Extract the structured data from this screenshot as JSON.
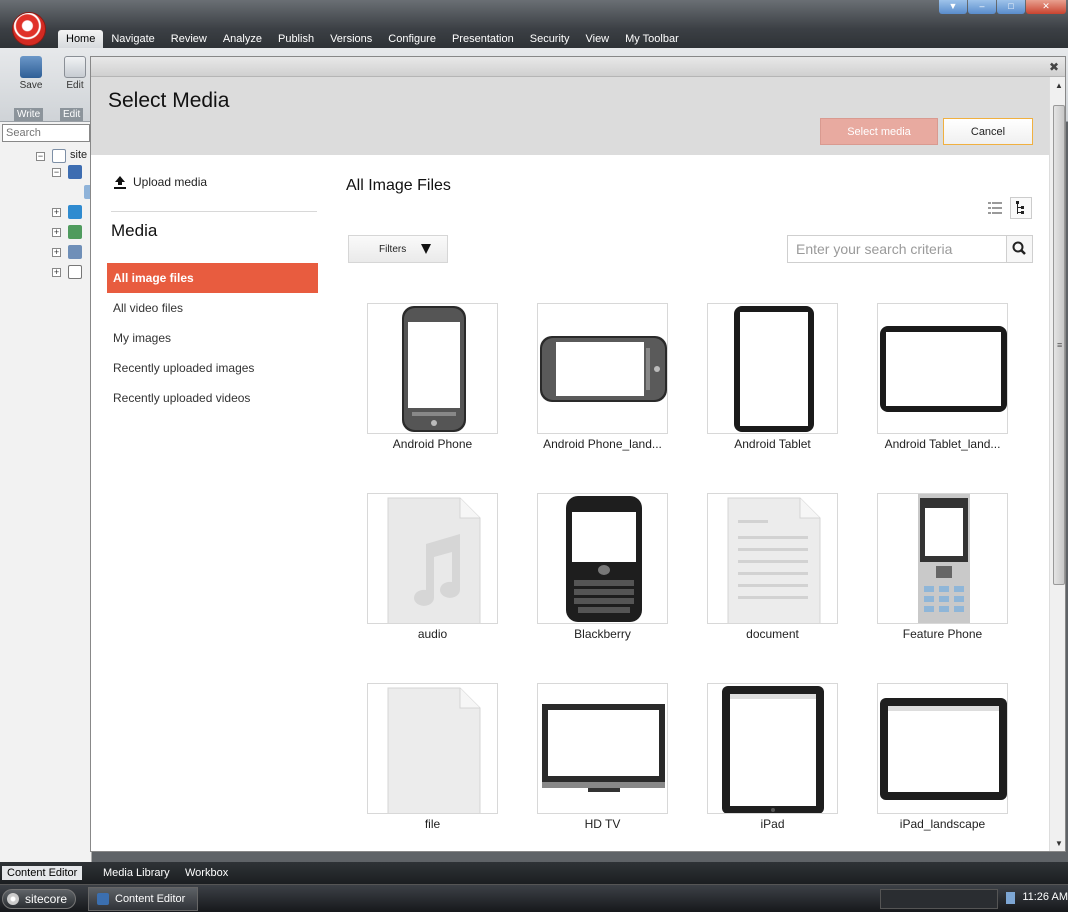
{
  "app": {
    "menu_tabs": [
      "Home",
      "Navigate",
      "Review",
      "Analyze",
      "Publish",
      "Versions",
      "Configure",
      "Presentation",
      "Security",
      "View",
      "My Toolbar"
    ],
    "ribbon": {
      "save_label": "Save",
      "edit_label": "Edit",
      "group_write": "Write",
      "group_edit": "Edit"
    },
    "tree": {
      "search_placeholder": "Search",
      "root_label": "site"
    },
    "bottom_tabs": [
      "Content Editor",
      "Media Library",
      "Workbox"
    ],
    "taskbar": {
      "start_label": "sitecore",
      "task_label": "Content Editor",
      "clock": "11:26 AM"
    }
  },
  "dialog": {
    "title": "Select Media",
    "select_button": "Select media",
    "cancel_button": "Cancel",
    "upload_label": "Upload media",
    "media_heading": "Media",
    "nav_items": [
      "All image files",
      "All video files",
      "My images",
      "Recently uploaded images",
      "Recently uploaded videos"
    ],
    "active_nav": "All image files",
    "content_title": "All Image Files",
    "filters_label": "Filters",
    "search_placeholder": "Enter your search criteria",
    "items": [
      {
        "caption": "Android Phone",
        "icon": "android-phone-icon"
      },
      {
        "caption": "Android Phone_land...",
        "icon": "android-phone-landscape-icon"
      },
      {
        "caption": "Android Tablet",
        "icon": "android-tablet-icon"
      },
      {
        "caption": "Android Tablet_land...",
        "icon": "android-tablet-landscape-icon"
      },
      {
        "caption": "audio",
        "icon": "audio-file-icon"
      },
      {
        "caption": "Blackberry",
        "icon": "blackberry-icon"
      },
      {
        "caption": "document",
        "icon": "document-file-icon"
      },
      {
        "caption": "Feature Phone",
        "icon": "feature-phone-icon"
      },
      {
        "caption": "file",
        "icon": "generic-file-icon"
      },
      {
        "caption": "HD TV",
        "icon": "hdtv-icon"
      },
      {
        "caption": "iPad",
        "icon": "ipad-icon"
      },
      {
        "caption": "iPad_landscape",
        "icon": "ipad-landscape-icon"
      }
    ]
  },
  "colors": {
    "accent": "#E85C3F",
    "select_button": "#E8AAA0",
    "cancel_border": "#F0B040",
    "header_bg": "#DCDCDC"
  }
}
